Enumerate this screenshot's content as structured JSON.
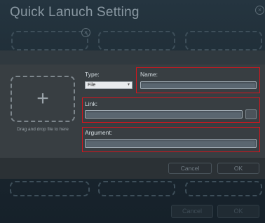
{
  "background_window": {
    "title": "Quick Lanuch Setting",
    "close_glyph": "×",
    "cancel_label": "Cancel",
    "ok_label": "OK"
  },
  "dialog": {
    "drop_zone": {
      "plus_glyph": "+",
      "hint": "Drag and drop file to here"
    },
    "type": {
      "label": "Type:",
      "selected": "File",
      "chevron": "▾"
    },
    "name": {
      "label": "Name:",
      "value": ""
    },
    "link": {
      "label": "Link:",
      "value": ""
    },
    "argument": {
      "label": "Argument:",
      "value": ""
    },
    "cancel_label": "Cancel",
    "ok_label": "OK"
  },
  "colors": {
    "highlight": "#d8141c",
    "dialog_bg": "#383e42"
  },
  "icons": {
    "add": "plus-icon",
    "browse": "browse-button",
    "close": "close-icon"
  }
}
